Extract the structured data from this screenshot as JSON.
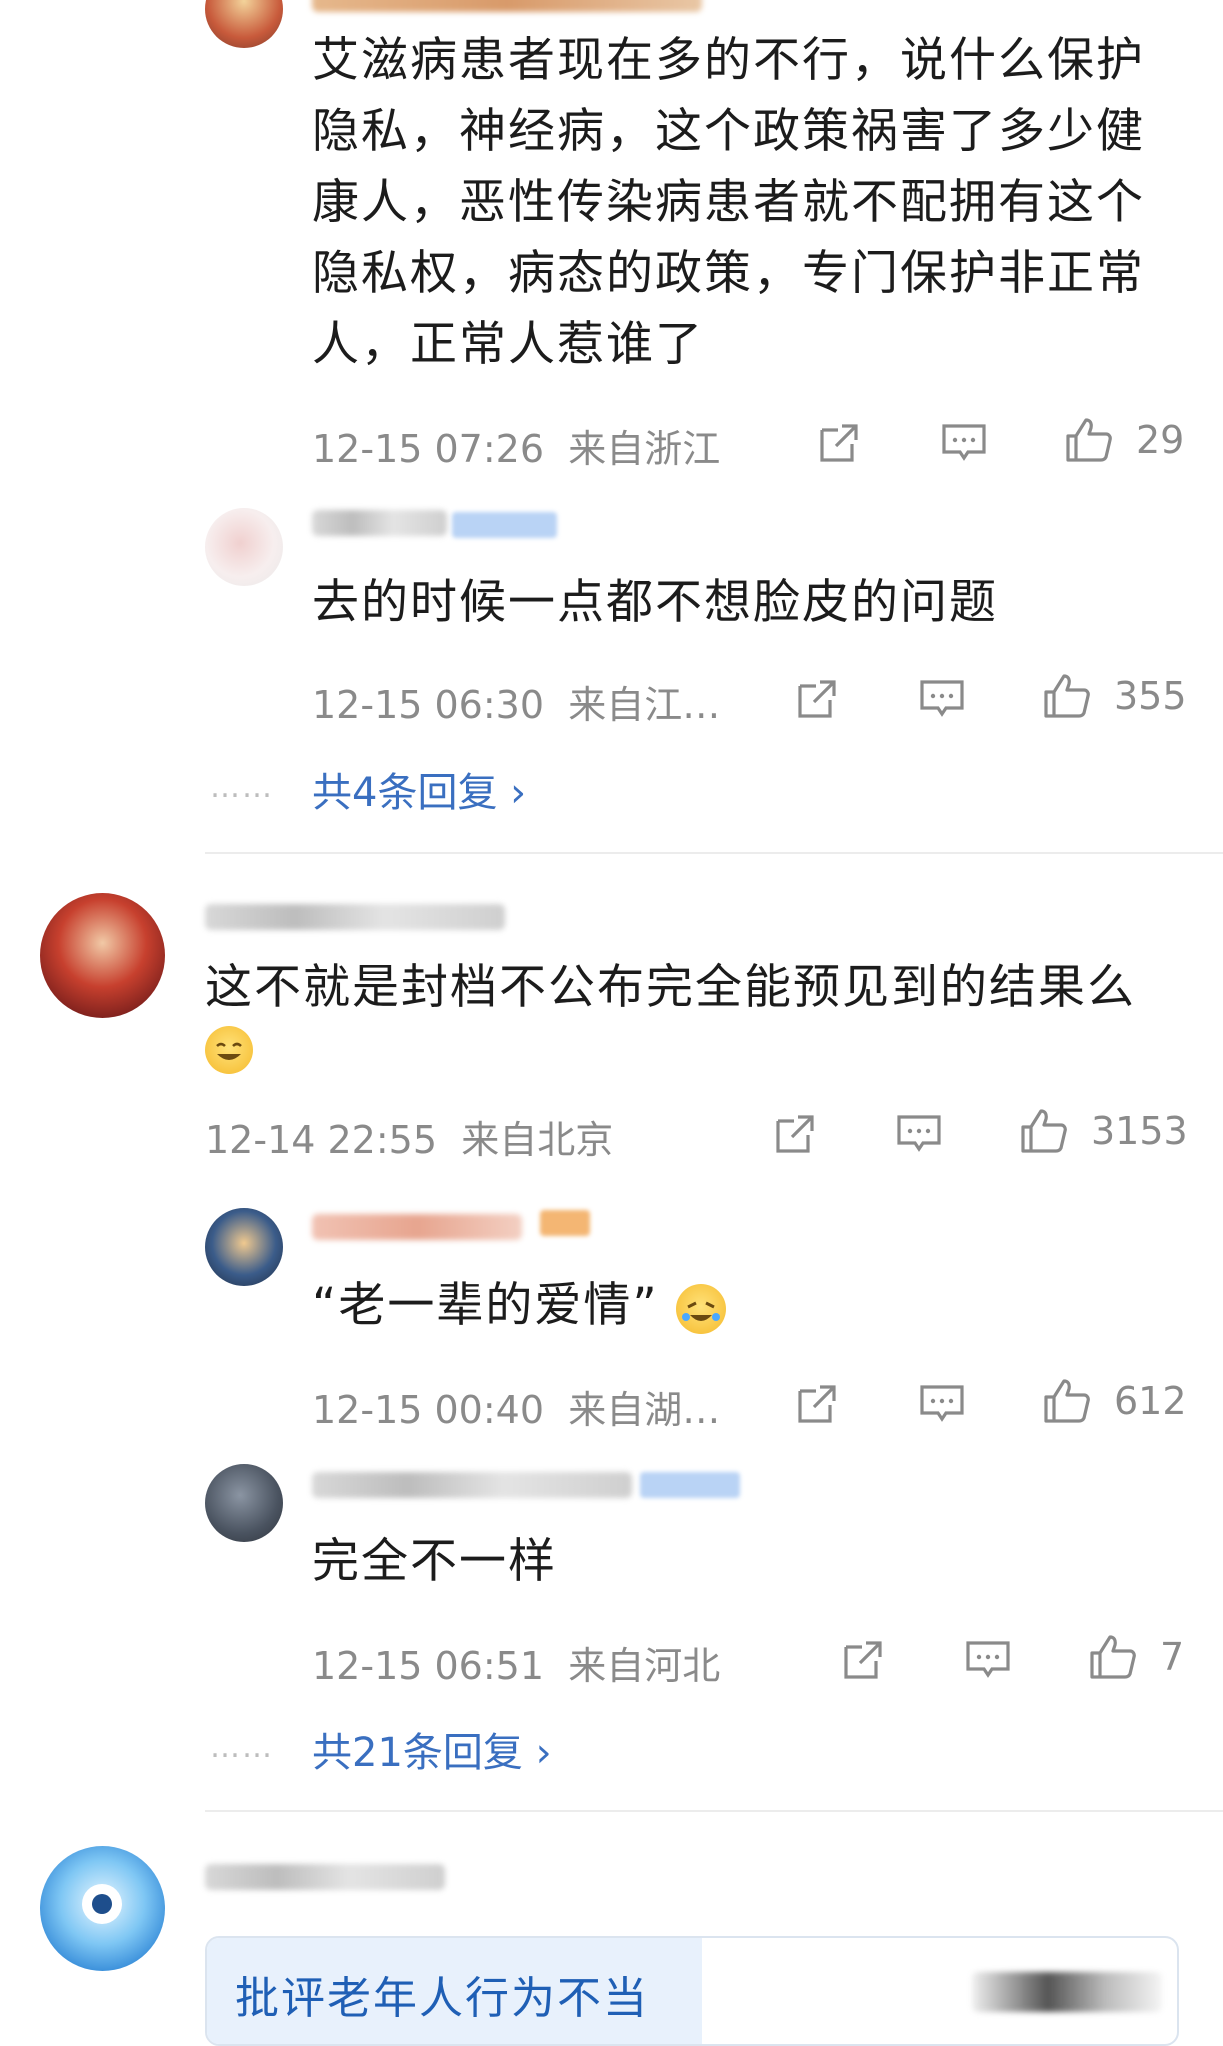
{
  "comments": [
    {
      "text": "艾滋病患者现在多的不行，说什么保护隐私，神经病，这个政策祸害了多少健康人，恶性传染病患者就不配拥有这个隐私权，病态的政策，专门保护非正常人，正常人惹谁了",
      "lines": [
        "艾滋病患者现在多的不行，说什么保护",
        "隐私，神经病，这个政策祸害了多少健",
        "康人，恶性传染病患者就不配拥有这个",
        "隐私权，病态的政策，专门保护非正常",
        "人，正常人惹谁了"
      ],
      "time": "12-15 07:26",
      "location": "来自浙江",
      "likes": "29"
    },
    {
      "text": "去的时候一点都不想脸皮的问题",
      "time": "12-15 06:30",
      "location": "来自江…",
      "likes": "355",
      "replies_link": "共4条回复 ›"
    },
    {
      "text": "这不就是封档不公布完全能预见到的结果么",
      "time": "12-14 22:55",
      "location": "来自北京",
      "likes": "3153"
    },
    {
      "text": "“老一辈的爱情”",
      "time": "12-15 00:40",
      "location": "来自湖…",
      "likes": "612"
    },
    {
      "text": "完全不一样",
      "time": "12-15 06:51",
      "location": "来自河北",
      "likes": "7",
      "replies_link": "共21条回复 ›"
    }
  ],
  "summary_box": {
    "text": "批评老年人行为不当"
  },
  "dots": "……",
  "icons": [
    "share-icon",
    "comment-icon",
    "like-icon",
    "laugh-emoji-icon",
    "rofl-emoji-icon"
  ],
  "colors": {
    "link": "#3a6fc0",
    "meta": "#8a8a8a",
    "summary_bg": "#e8f1fc"
  }
}
